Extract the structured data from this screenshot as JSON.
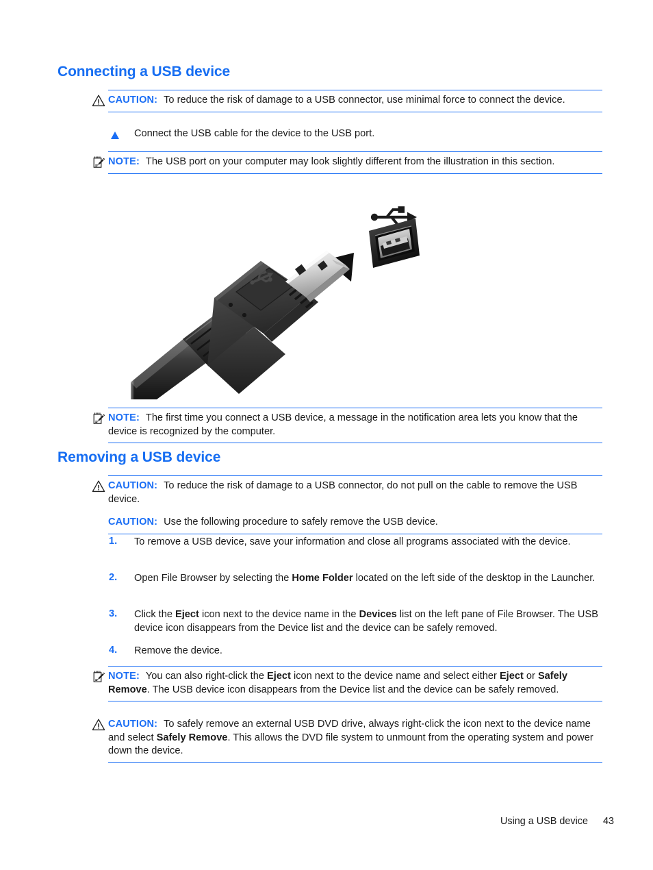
{
  "document": {
    "page_number": "43",
    "footer_title": "Using a USB device"
  },
  "sections": [
    {
      "heading": "Connecting a USB device"
    },
    {
      "heading": "Removing a USB device"
    }
  ],
  "labels": {
    "caution": "CAUTION:",
    "note": "NOTE:"
  },
  "connecting": {
    "caution_1": "To reduce the risk of damage to a USB connector, use minimal force to connect the device.",
    "bullet_1": "Connect the USB cable for the device to the USB port.",
    "note_1": "The USB port on your computer may look slightly different from the illustration in this section.",
    "note_2": "The first time you connect a USB device, a message in the notification area lets you know that the device is recognized by the computer."
  },
  "figure": {
    "caption": "",
    "parts": {
      "cable_plug": "usb-type-a-plug",
      "arrow": "insertion-arrow",
      "port": "usb-port-receptacle",
      "symbol": "usb-trident-symbol"
    }
  },
  "removing": {
    "caution_1": "To reduce the risk of damage to a USB connector, do not pull on the cable to remove the USB device.",
    "caution_2": "Use the following procedure to safely remove the USB device.",
    "steps": [
      {
        "num": "1.",
        "parts": [
          {
            "text": "To remove a USB device, save your information and close all programs associated with the device.",
            "bold": false
          }
        ]
      },
      {
        "num": "2.",
        "parts": [
          {
            "text": "Open File Browser by selecting the ",
            "bold": false
          },
          {
            "text": "Home Folder",
            "bold": true
          },
          {
            "text": " located on the left side of the desktop in the Launcher.",
            "bold": false
          }
        ]
      },
      {
        "num": "3.",
        "parts": [
          {
            "text": "Click the ",
            "bold": false
          },
          {
            "text": "Eject",
            "bold": true
          },
          {
            "text": " icon next to the device name in the ",
            "bold": false
          },
          {
            "text": "Devices",
            "bold": true
          },
          {
            "text": " list on the left pane of File Browser. The USB device icon disappears from the Device list and the device can be safely removed.",
            "bold": false
          }
        ]
      },
      {
        "num": "4.",
        "parts": [
          {
            "text": "Remove the device.",
            "bold": false
          }
        ]
      }
    ],
    "note_1": [
      {
        "text": "You can also right-click the ",
        "bold": false
      },
      {
        "text": "Eject",
        "bold": true
      },
      {
        "text": " icon next to the device name and select either ",
        "bold": false
      },
      {
        "text": "Eject",
        "bold": true
      },
      {
        "text": " or ",
        "bold": false
      },
      {
        "text": "Safely Remove",
        "bold": true
      },
      {
        "text": ". The USB device icon disappears from the Device list and the device can be safely removed.",
        "bold": false
      }
    ],
    "caution_3": [
      {
        "text": "To safely remove an external USB DVD drive, always right-click the icon next to the device name and select ",
        "bold": false
      },
      {
        "text": "Safely Remove",
        "bold": true
      },
      {
        "text": ". This allows the DVD file system to unmount from the operating system and power down the device.",
        "bold": false
      }
    ]
  },
  "colors": {
    "accent_blue": "#1a6ef5",
    "heading_blue": "#176ef2",
    "body_black": "#1a1a1a",
    "rule_blue": "#1a6ef5"
  }
}
